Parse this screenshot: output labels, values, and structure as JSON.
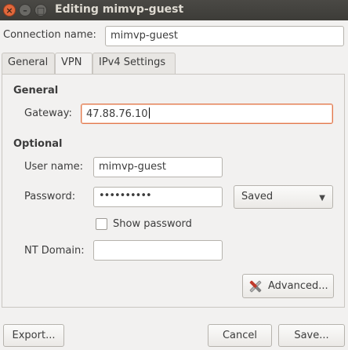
{
  "window": {
    "title": "Editing mimvp-guest",
    "close_glyph": "×",
    "min_glyph": "–",
    "max_glyph": "□"
  },
  "connection": {
    "label": "Connection name:",
    "value": "mimvp-guest"
  },
  "tabs": [
    {
      "label": "General"
    },
    {
      "label": "VPN",
      "active": true
    },
    {
      "label": "IPv4 Settings"
    }
  ],
  "vpn": {
    "general_heading": "General",
    "gateway_label": "Gateway:",
    "gateway_value": "47.88.76.10",
    "optional_heading": "Optional",
    "username_label": "User name:",
    "username_value": "mimvp-guest",
    "password_label": "Password:",
    "password_mask": "••••••••••",
    "password_storage": "Saved",
    "password_storage_arrow": "▼",
    "show_password_label": "Show password",
    "show_password_checked": false,
    "ntdomain_label": "NT Domain:",
    "ntdomain_value": "",
    "advanced_label": "Advanced...",
    "advanced_icon": "tools-icon"
  },
  "footer": {
    "export_label": "Export...",
    "cancel_label": "Cancel",
    "save_label": "Save..."
  },
  "colors": {
    "titlebar": "#3d3c38",
    "focus_border": "#e2794f",
    "close_button": "#e0683c"
  }
}
